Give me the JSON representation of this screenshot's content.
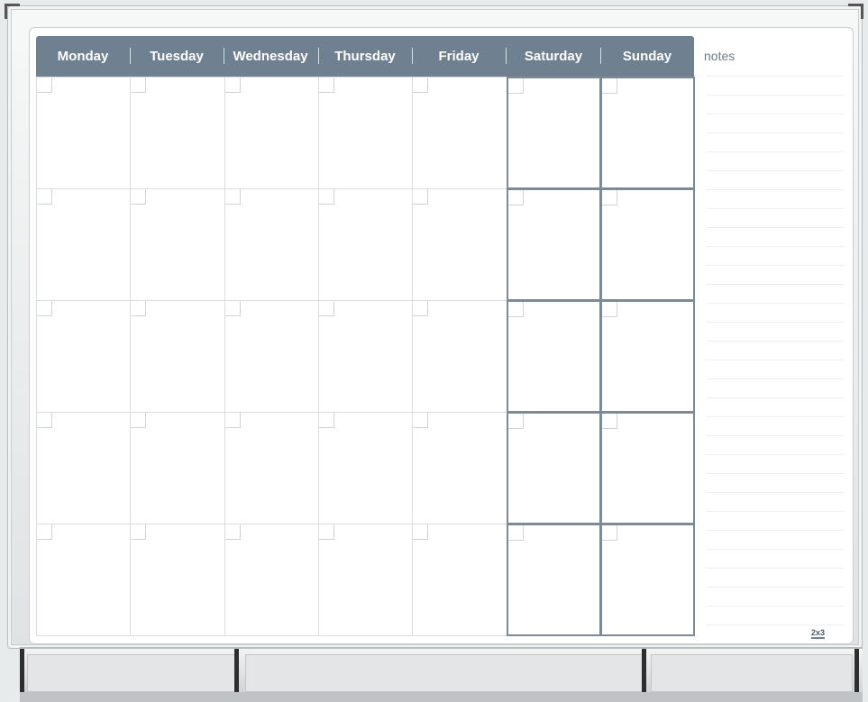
{
  "calendar": {
    "days": [
      "Monday",
      "Tuesday",
      "Wednesday",
      "Thursday",
      "Friday",
      "Saturday",
      "Sunday"
    ],
    "rows": 5,
    "weekend_days": [
      "Saturday",
      "Sunday"
    ],
    "header_color": "#6f8190",
    "weekend_border_color": "#7d8b96"
  },
  "notes": {
    "label": "notes"
  },
  "brand": {
    "logo_text": "2x3"
  }
}
